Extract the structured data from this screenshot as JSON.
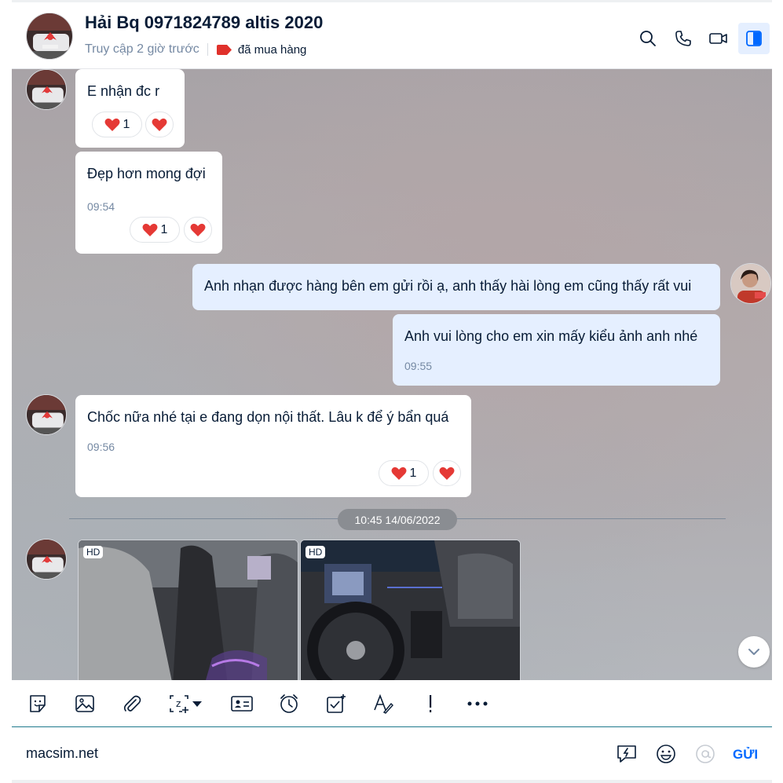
{
  "header": {
    "contact_name": "Hải Bq 0971824789 altis 2020",
    "last_seen": "Truy cập 2 giờ trước",
    "tag_label": "đã mua hàng",
    "tag_color": "#e0312b",
    "icons": [
      "search-icon",
      "phone-icon",
      "video-icon",
      "side-panel-icon"
    ]
  },
  "messages": [
    {
      "sender": "contact",
      "text": "E nhận đc r",
      "reaction_count": "1"
    },
    {
      "sender": "contact",
      "text": "Đẹp hơn mong đợi",
      "time": "09:54",
      "reaction_count": "1"
    },
    {
      "sender": "me",
      "text": "Anh nhạn được hàng bên em gửi rồi ạ, anh thấy hài lòng em cũng thấy rất vui"
    },
    {
      "sender": "me",
      "text": "Anh vui lòng cho em xin mấy kiểu ảnh anh nhé",
      "time": "09:55"
    },
    {
      "sender": "contact",
      "text": "Chốc nữa nhé tại e đang dọn nội thất. Lâu k để ý bẩn quá",
      "time": "09:56",
      "reaction_count": "1"
    }
  ],
  "date_divider": "10:45 14/06/2022",
  "photos": [
    {
      "badge": "HD"
    },
    {
      "badge": "HD"
    }
  ],
  "toolbar": {
    "icons": [
      "sticker-icon",
      "image-icon",
      "attachment-icon",
      "screenshot-icon",
      "dropdown-caret-icon",
      "contact-card-icon",
      "reminder-clock-icon",
      "task-icon",
      "text-format-icon",
      "important-icon",
      "more-icon"
    ]
  },
  "composer": {
    "input_value": "macsim.net",
    "send_label": "GỬI",
    "icons": [
      "quick-message-icon",
      "emoji-icon",
      "mention-icon"
    ]
  },
  "colors": {
    "accent": "#0068ff",
    "my_bubble": "#e5efff",
    "heart": "#e53935"
  }
}
